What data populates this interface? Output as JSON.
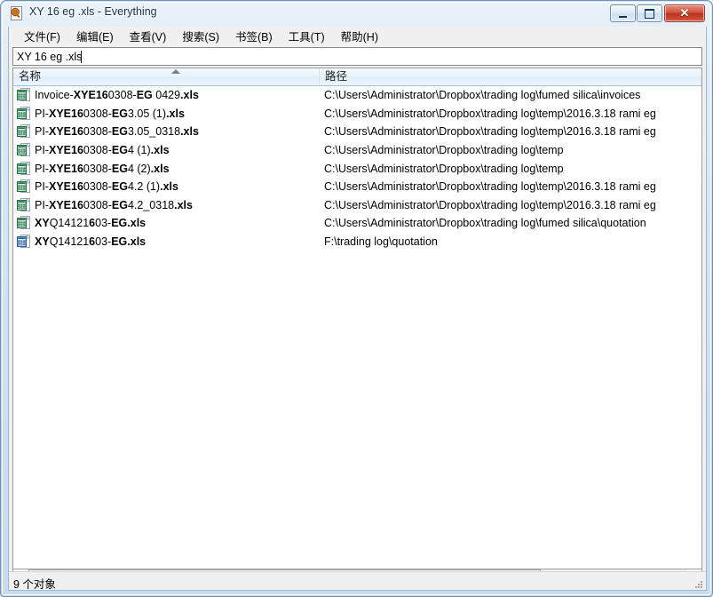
{
  "window": {
    "title": "XY 16 eg .xls - Everything",
    "icon": "everything-magnifier-icon",
    "controls": {
      "minimize_label": "",
      "maximize_label": "",
      "close_label": "✕"
    }
  },
  "menubar": {
    "items": [
      {
        "label": "文件(F)",
        "name": "menu-file"
      },
      {
        "label": "编辑(E)",
        "name": "menu-edit"
      },
      {
        "label": "查看(V)",
        "name": "menu-view"
      },
      {
        "label": "搜索(S)",
        "name": "menu-search"
      },
      {
        "label": "书签(B)",
        "name": "menu-bookmarks"
      },
      {
        "label": "工具(T)",
        "name": "menu-tools"
      },
      {
        "label": "帮助(H)",
        "name": "menu-help"
      }
    ]
  },
  "search": {
    "value": "XY 16 eg .xls",
    "placeholder": ""
  },
  "list": {
    "columns": [
      {
        "label": "名称",
        "name": "column-name",
        "sorted": "asc"
      },
      {
        "label": "路径",
        "name": "column-path",
        "sorted": "none"
      }
    ],
    "rows": [
      {
        "icon": "excel-xls-green-icon",
        "name_parts": [
          {
            "t": "Invoice-",
            "b": false
          },
          {
            "t": "XY",
            "b": true
          },
          {
            "t": "E",
            "b": true
          },
          {
            "t": "16",
            "b": true
          },
          {
            "t": "0308-",
            "b": false
          },
          {
            "t": "EG",
            "b": true
          },
          {
            "t": " 0429",
            "b": false
          },
          {
            "t": ".xls",
            "b": true
          }
        ],
        "name_plain": "Invoice-XYE160308-EG 0429.xls",
        "path": "C:\\Users\\Administrator\\Dropbox\\trading log\\fumed silica\\invoices"
      },
      {
        "icon": "excel-xls-green-icon",
        "name_parts": [
          {
            "t": "PI-",
            "b": false
          },
          {
            "t": "XY",
            "b": true
          },
          {
            "t": "E",
            "b": true
          },
          {
            "t": "16",
            "b": true
          },
          {
            "t": "0308-",
            "b": false
          },
          {
            "t": "EG",
            "b": true
          },
          {
            "t": "3.05 (1)",
            "b": false
          },
          {
            "t": ".xls",
            "b": true
          }
        ],
        "name_plain": "PI-XYE160308-EG3.05 (1).xls",
        "path": "C:\\Users\\Administrator\\Dropbox\\trading log\\temp\\2016.3.18 rami eg"
      },
      {
        "icon": "excel-xls-green-icon",
        "name_parts": [
          {
            "t": "PI-",
            "b": false
          },
          {
            "t": "XY",
            "b": true
          },
          {
            "t": "E",
            "b": true
          },
          {
            "t": "16",
            "b": true
          },
          {
            "t": "0308-",
            "b": false
          },
          {
            "t": "EG",
            "b": true
          },
          {
            "t": "3.05_0318",
            "b": false
          },
          {
            "t": ".xls",
            "b": true
          }
        ],
        "name_plain": "PI-XYE160308-EG3.05_0318.xls",
        "path": "C:\\Users\\Administrator\\Dropbox\\trading log\\temp\\2016.3.18 rami eg"
      },
      {
        "icon": "excel-xls-green-icon",
        "name_parts": [
          {
            "t": "PI-",
            "b": false
          },
          {
            "t": "XY",
            "b": true
          },
          {
            "t": "E",
            "b": true
          },
          {
            "t": "16",
            "b": true
          },
          {
            "t": "0308-",
            "b": false
          },
          {
            "t": "EG",
            "b": true
          },
          {
            "t": "4 (1)",
            "b": false
          },
          {
            "t": ".xls",
            "b": true
          }
        ],
        "name_plain": "PI-XYE160308-EG4 (1).xls",
        "path": "C:\\Users\\Administrator\\Dropbox\\trading log\\temp"
      },
      {
        "icon": "excel-xls-green-icon",
        "name_parts": [
          {
            "t": "PI-",
            "b": false
          },
          {
            "t": "XY",
            "b": true
          },
          {
            "t": "E",
            "b": true
          },
          {
            "t": "16",
            "b": true
          },
          {
            "t": "0308-",
            "b": false
          },
          {
            "t": "EG",
            "b": true
          },
          {
            "t": "4 (2)",
            "b": false
          },
          {
            "t": ".xls",
            "b": true
          }
        ],
        "name_plain": "PI-XYE160308-EG4 (2).xls",
        "path": "C:\\Users\\Administrator\\Dropbox\\trading log\\temp"
      },
      {
        "icon": "excel-xls-green-icon",
        "name_parts": [
          {
            "t": "PI-",
            "b": false
          },
          {
            "t": "XY",
            "b": true
          },
          {
            "t": "E",
            "b": true
          },
          {
            "t": "16",
            "b": true
          },
          {
            "t": "0308-",
            "b": false
          },
          {
            "t": "EG",
            "b": true
          },
          {
            "t": "4.2 (1)",
            "b": false
          },
          {
            "t": ".xls",
            "b": true
          }
        ],
        "name_plain": "PI-XYE160308-EG4.2 (1).xls",
        "path": "C:\\Users\\Administrator\\Dropbox\\trading log\\temp\\2016.3.18 rami eg"
      },
      {
        "icon": "excel-xls-green-icon",
        "name_parts": [
          {
            "t": "PI-",
            "b": false
          },
          {
            "t": "XY",
            "b": true
          },
          {
            "t": "E",
            "b": true
          },
          {
            "t": "16",
            "b": true
          },
          {
            "t": "0308-",
            "b": false
          },
          {
            "t": "EG",
            "b": true
          },
          {
            "t": "4.2_0318",
            "b": false
          },
          {
            "t": ".xls",
            "b": true
          }
        ],
        "name_plain": "PI-XYE160308-EG4.2_0318.xls",
        "path": "C:\\Users\\Administrator\\Dropbox\\trading log\\temp\\2016.3.18 rami eg"
      },
      {
        "icon": "excel-xls-green-icon",
        "name_parts": [
          {
            "t": "XY",
            "b": true
          },
          {
            "t": "Q14121",
            "b": false
          },
          {
            "t": "6",
            "b": true
          },
          {
            "t": "03-",
            "b": false
          },
          {
            "t": "EG",
            "b": true
          },
          {
            "t": ".xls",
            "b": true
          }
        ],
        "name_plain": "XYQ14121603-EG.xls",
        "path": "C:\\Users\\Administrator\\Dropbox\\trading log\\fumed silica\\quotation"
      },
      {
        "icon": "excel-xls-blue-icon",
        "name_parts": [
          {
            "t": "XY",
            "b": true
          },
          {
            "t": "Q14121",
            "b": false
          },
          {
            "t": "6",
            "b": true
          },
          {
            "t": "03-",
            "b": false
          },
          {
            "t": "EG",
            "b": true
          },
          {
            "t": ".xls",
            "b": true
          }
        ],
        "name_plain": "XYQ14121603-EG.xls",
        "path": "F:\\trading log\\quotation"
      }
    ]
  },
  "statusbar": {
    "text": "9 个对象"
  },
  "colors": {
    "titlebar_text": "#16334e",
    "close_button": "#b9301c",
    "header_gradient_top": "#f4f9fd",
    "list_background": "#ffffff",
    "excel_green": "#1e7145",
    "excel_blue": "#2a6099"
  }
}
